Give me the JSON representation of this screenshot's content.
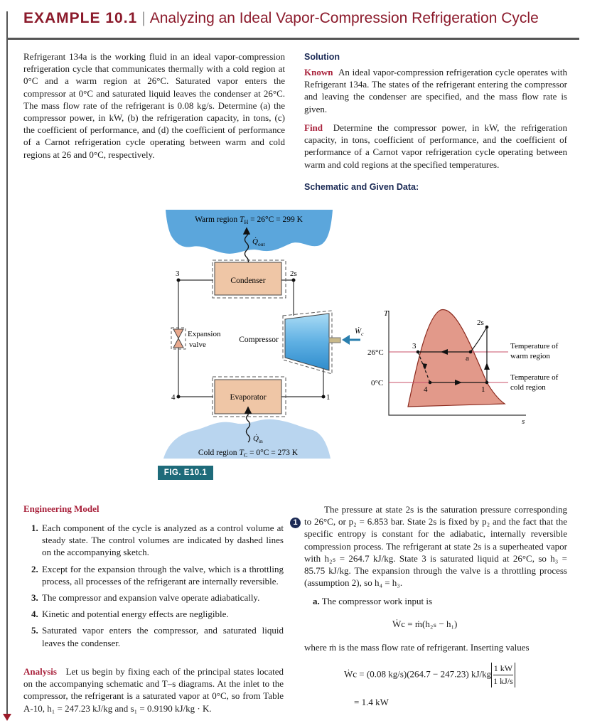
{
  "header": {
    "example": "EXAMPLE 10.1",
    "separator": "|",
    "title": "Analyzing an Ideal Vapor-Compression Refrigeration Cycle"
  },
  "problem": "Refrigerant 134a is the working fluid in an ideal vapor-compression refrigeration cycle that communicates thermally with a cold region at 0°C and a warm region at 26°C. Saturated vapor enters the compressor at 0°C and saturated liquid leaves the condenser at 26°C. The mass flow rate of the refrigerant is 0.08 kg/s. Determine (a) the compressor power, in kW, (b) the refrigeration capacity, in tons, (c) the coefficient of performance, and (d) the coefficient of performance of a Carnot refrigeration cycle operating between warm and cold regions at 26 and 0°C, respectively.",
  "solution": {
    "heading": "Solution",
    "known_label": "Known",
    "known": "An ideal vapor-compression refrigeration cycle operates with Refrigerant 134a. The states of the refrigerant entering the compressor and leaving the condenser are specified, and the mass flow rate is given.",
    "find_label": "Find",
    "find": "Determine the compressor power, in kW, the refrigeration capacity, in tons, coefficient of performance, and the coefficient of performance of a Carnot vapor refrigeration cycle operating between warm and cold regions at the specified temperatures.",
    "schematic_heading": "Schematic and Given Data:"
  },
  "schematic": {
    "warm_region": {
      "label": "Warm region ",
      "symbol": "T",
      "sub": "H",
      "value": " = 26°C = 299 K"
    },
    "q_out": {
      "symbol": "Q̇",
      "sub": "out"
    },
    "condenser": "Condenser",
    "compressor": "Compressor",
    "evaporator": "Evaporator",
    "expansion_valve": [
      "Expansion",
      "valve"
    ],
    "w_c": {
      "symbol": "Ẇ",
      "sub": "c"
    },
    "q_in": {
      "symbol": "Q̇",
      "sub": "in"
    },
    "cold_region": {
      "label": "Cold region ",
      "symbol": "T",
      "sub": "C",
      "value": " = 0°C = 273 K"
    },
    "states": {
      "s1": "1",
      "s2s": "2s",
      "s3": "3",
      "s4": "4"
    },
    "figure_label": "FIG. E10.1",
    "colors": {
      "warm": "#5ba6dc",
      "cold": "#b9d5ef",
      "box": "#efc6a6",
      "compressor": "#7cc0e8",
      "work_arrow": "#2a7fae"
    }
  },
  "ts_diagram": {
    "y_axis": "T",
    "x_axis": "s",
    "t_high": "26°C",
    "t_low": "0°C",
    "points": {
      "p1": "1",
      "p2s": "2s",
      "p3": "3",
      "p4": "4",
      "pa": "a"
    },
    "warm_label": [
      "Temperature of",
      "warm region"
    ],
    "cold_label": [
      "Temperature of",
      "cold region"
    ],
    "colors": {
      "dome": "#e2998a",
      "isotherm": "#c8506a"
    }
  },
  "engineering_model": {
    "heading": "Engineering Model",
    "items": [
      {
        "n": "1.",
        "text": "Each component of the cycle is analyzed as a control volume at steady state. The control volumes are indicated by dashed lines on the accompanying sketch."
      },
      {
        "n": "2.",
        "text": "Except for the expansion through the valve, which is a throttling process, all processes of the refrigerant are internally reversible."
      },
      {
        "n": "3.",
        "text": "The compressor and expansion valve operate adiabatically."
      },
      {
        "n": "4.",
        "text": "Kinetic and potential energy effects are negligible."
      },
      {
        "n": "5.",
        "text": "Saturated vapor enters the compressor, and saturated liquid leaves the condenser."
      }
    ]
  },
  "analysis": {
    "label": "Analysis",
    "text": "Let us begin by fixing each of the principal states located on the accompanying schematic and T–s diagrams. At the inlet to the compressor, the refrigerant is a saturated vapor at 0°C, so from Table A-10, h₁ = 247.23 kJ/kg and s₁ = 0.9190 kJ/kg · K."
  },
  "right": {
    "note_number": "1",
    "paragraph": "The pressure at state 2s is the saturation pressure corresponding to 26°C, or p₂ = 6.853 bar. State 2s is fixed by p₂ and the fact that the specific entropy is constant for the adiabatic, internally reversible compression process. The refrigerant at state 2s is a superheated vapor with h₂ₛ = 264.7 kJ/kg. State 3 is saturated liquid at 26°C, so h₃ = 85.75 kJ/kg. The expansion through the valve is a throttling process (assumption 2), so h₄ = h₃.",
    "part_a_label": "a.",
    "part_a": "The compressor work input is",
    "eq1": "Ẇc = ṁ(h₂ₛ − h₁)",
    "where": "where ṁ is the mass flow rate of refrigerant. Inserting values",
    "eq2": "Ẇc = (0.08 kg/s)(264.7 − 247.23) kJ/kg",
    "eq2_frac_top": "1 kW",
    "eq2_frac_bottom": "1 kJ/s",
    "result": "= 1.4 kW"
  }
}
